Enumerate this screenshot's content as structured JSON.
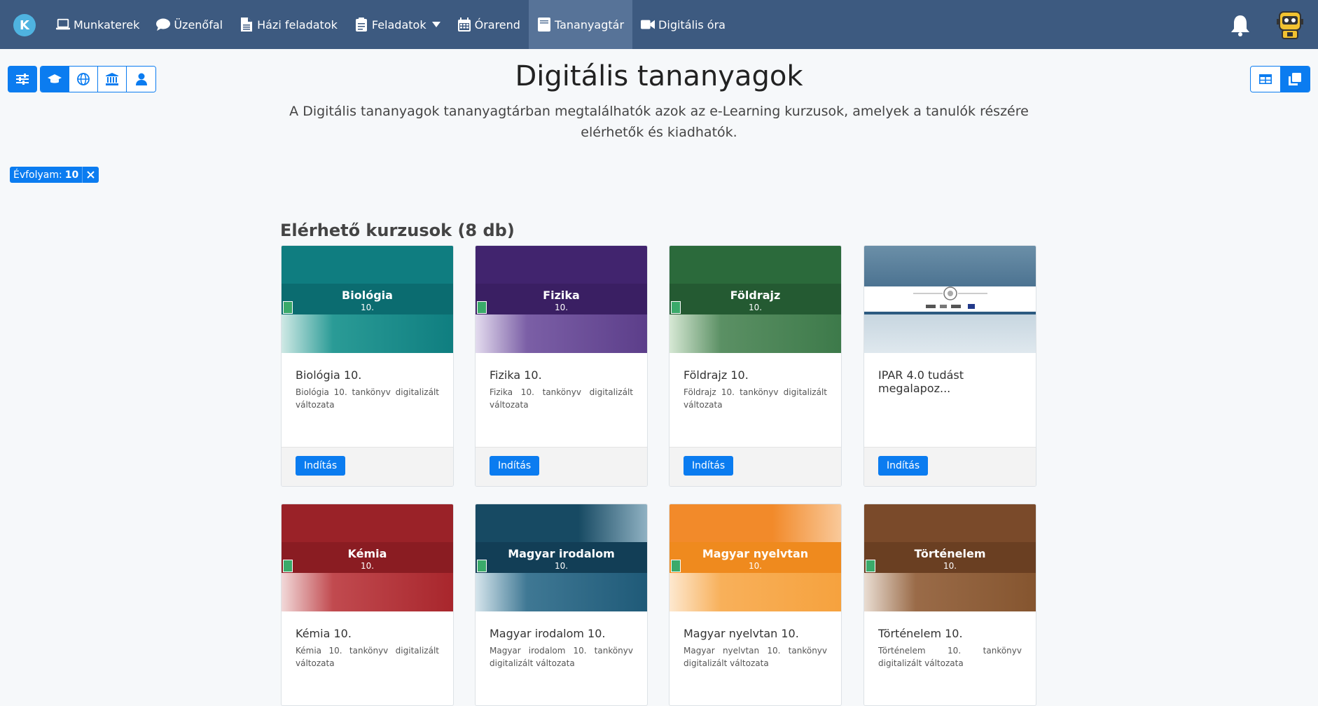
{
  "nav": {
    "logo_letter": "K",
    "items": [
      {
        "label": "Munkaterek",
        "icon": "laptop-icon"
      },
      {
        "label": "Üzenőfal",
        "icon": "comment-icon"
      },
      {
        "label": "Házi feladatok",
        "icon": "file-icon"
      },
      {
        "label": "Feladatok",
        "icon": "clipboard-icon"
      },
      {
        "label": "Órarend",
        "icon": "calendar-icon"
      },
      {
        "label": "Tananyagtár",
        "icon": "book-icon"
      },
      {
        "label": "Digitális óra",
        "icon": "video-icon"
      }
    ]
  },
  "header": {
    "title": "Digitális tananyagok",
    "description": "A Digitális tananyagok tananyagtárban megtalálhatók azok az e-Learning kurzusok, amelyek a tanulók részére elérhetők és kiadhatók."
  },
  "filter_chip": {
    "label": "Évfolyam:",
    "value": "10"
  },
  "section": {
    "title": "Elérhető kurzusok (8 db)"
  },
  "colors": {
    "accent": "#0b7cf0",
    "navbar": "#3d5a80",
    "nav_active": "#577398"
  },
  "courses": [
    {
      "thumb_title": "Biológia",
      "thumb_grade": "10.",
      "title": "Biológia 10.",
      "desc": "Biológia 10. tankönyv digitalizált változata",
      "button": "Indítás"
    },
    {
      "thumb_title": "Fizika",
      "thumb_grade": "10.",
      "title": "Fizika 10.",
      "desc": "Fizika 10. tankönyv digitalizált változata",
      "button": "Indítás"
    },
    {
      "thumb_title": "Földrajz",
      "thumb_grade": "10.",
      "title": "Földrajz 10.",
      "desc": "Földrajz 10. tankönyv digitalizált változata",
      "button": "Indítás"
    },
    {
      "thumb_title": "",
      "thumb_grade": "",
      "title": "IPAR 4.0 tudást megalapoz...",
      "desc": "",
      "button": "Indítás"
    },
    {
      "thumb_title": "Kémia",
      "thumb_grade": "10.",
      "title": "Kémia 10.",
      "desc": "Kémia 10. tankönyv digitalizált változata",
      "button": "Indítás"
    },
    {
      "thumb_title": "Magyar irodalom",
      "thumb_grade": "10.",
      "title": "Magyar irodalom 10.",
      "desc": "Magyar irodalom 10. tankönyv digitalizált változata",
      "button": "Indítás"
    },
    {
      "thumb_title": "Magyar nyelvtan",
      "thumb_grade": "10.",
      "title": "Magyar nyelvtan 10.",
      "desc": "Magyar nyelvtan 10. tankönyv digitalizált változata",
      "button": "Indítás"
    },
    {
      "thumb_title": "Történelem",
      "thumb_grade": "10.",
      "title": "Történelem 10.",
      "desc": "Történelem 10. tankönyv digitalizált változata",
      "button": "Indítás"
    }
  ]
}
